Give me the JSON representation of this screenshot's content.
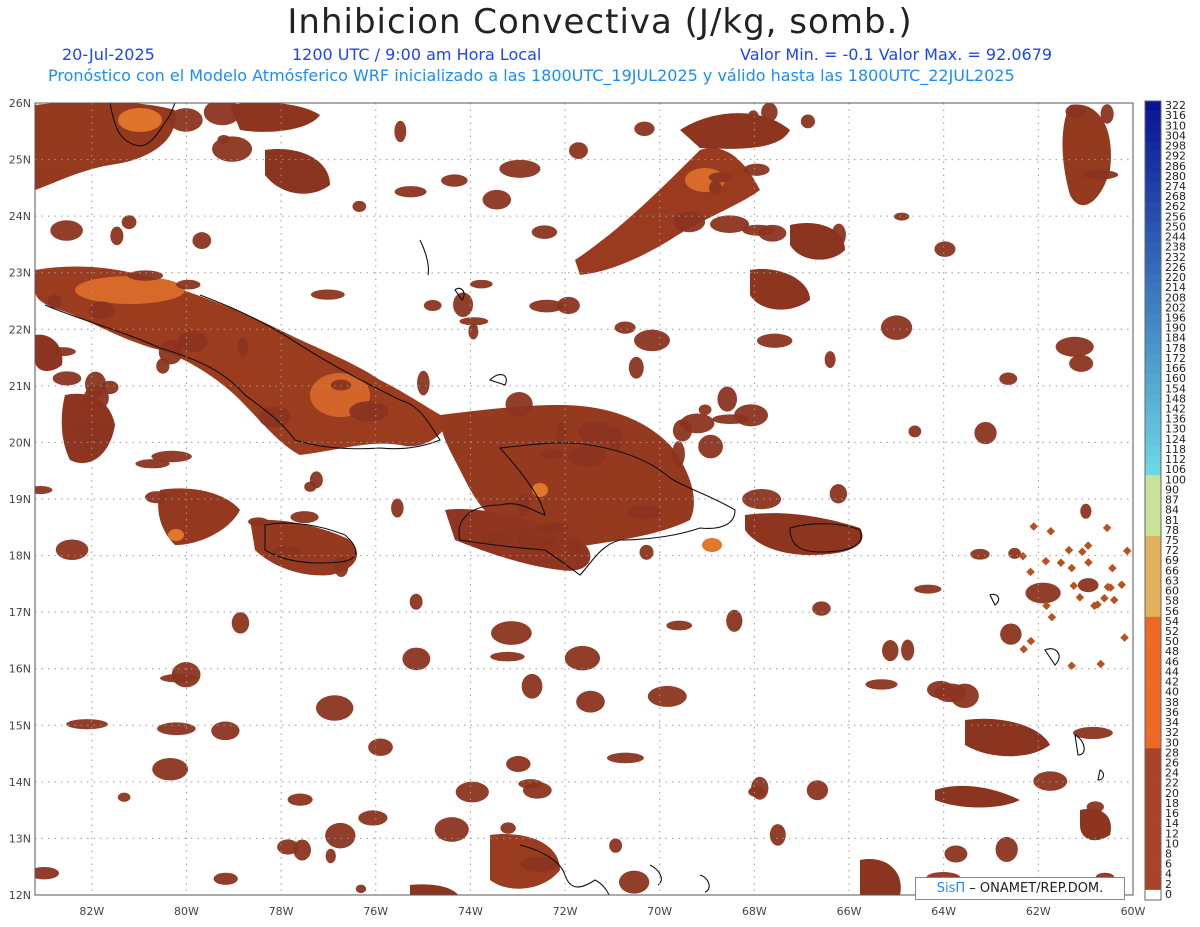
{
  "header": {
    "title": "Inhibicion Convectiva (J/kg, somb.)",
    "date": "20-Jul-2025",
    "time": "1200 UTC / 9:00 am Hora Local",
    "range": "Valor Min. = -0.1  Valor Max. = 92.0679",
    "info": "Pronóstico con el Modelo Atmósferico WRF inicializado a las 1800UTC_19JUL2025 y válido hasta las  1800UTC_22JUL2025"
  },
  "axes": {
    "lat_labels": [
      "26N",
      "25N",
      "24N",
      "23N",
      "22N",
      "21N",
      "20N",
      "19N",
      "18N",
      "17N",
      "16N",
      "15N",
      "14N",
      "13N",
      "12N"
    ],
    "lon_labels": [
      "82W",
      "80W",
      "78W",
      "76W",
      "74W",
      "72W",
      "70W",
      "68W",
      "66W",
      "64W",
      "62W",
      "60W"
    ],
    "lat_range": [
      12,
      26
    ],
    "lon_range": [
      -83.2,
      -60
    ]
  },
  "colorbar": {
    "labels": [
      "322",
      "316",
      "310",
      "304",
      "298",
      "292",
      "286",
      "280",
      "274",
      "268",
      "262",
      "256",
      "250",
      "244",
      "238",
      "232",
      "226",
      "220",
      "214",
      "208",
      "202",
      "196",
      "190",
      "184",
      "178",
      "172",
      "166",
      "160",
      "154",
      "148",
      "142",
      "136",
      "130",
      "124",
      "118",
      "112",
      "106",
      "100",
      "90",
      "87",
      "84",
      "81",
      "78",
      "75",
      "72",
      "69",
      "66",
      "63",
      "60",
      "58",
      "56",
      "54",
      "52",
      "50",
      "48",
      "46",
      "44",
      "42",
      "40",
      "38",
      "36",
      "34",
      "32",
      "30",
      "28",
      "26",
      "24",
      "22",
      "20",
      "18",
      "16",
      "14",
      "12",
      "10",
      "8",
      "6",
      "4",
      "2",
      "0"
    ]
  },
  "credit": {
    "sis": "SisΠ",
    "org": "– ONAMET/REP.DOM."
  },
  "colors": {
    "field_base": "#8b3420",
    "field_mid": "#b8501f",
    "field_high": "#e0772a",
    "grid": "#9a9a9a",
    "coast": "#111111"
  }
}
